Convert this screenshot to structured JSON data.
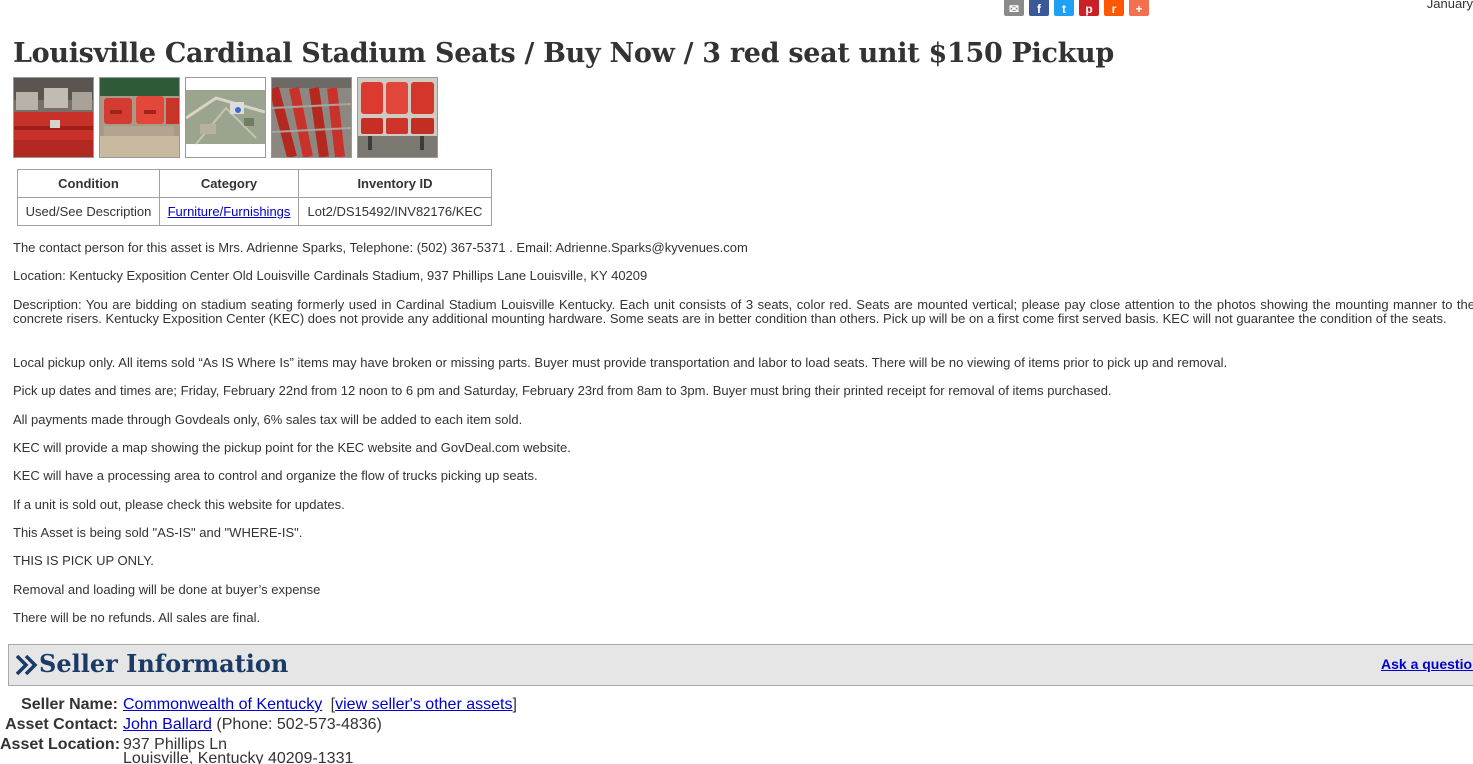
{
  "header": {
    "share_icons": [
      {
        "name": "email-share-icon",
        "glyph": "✉",
        "color": "#8a8a8a"
      },
      {
        "name": "facebook-share-icon",
        "glyph": "f",
        "color": "#3b5998"
      },
      {
        "name": "twitter-share-icon",
        "glyph": "t",
        "color": "#1da1f2"
      },
      {
        "name": "pinterest-share-icon",
        "glyph": "p",
        "color": "#cb2027"
      },
      {
        "name": "reddit-share-icon",
        "glyph": "r",
        "color": "#ff5700"
      },
      {
        "name": "more-share-icon",
        "glyph": "+",
        "color": "#f26f4f"
      }
    ],
    "date_text": "January"
  },
  "listing": {
    "title": "Louisville Cardinal Stadium Seats / Buy Now / 3 red seat unit $150 Pickup",
    "thumbnails": [
      "seat-photo-1",
      "seat-photo-2",
      "aerial-map-photo",
      "seat-rows-photo",
      "seat-unit-photo"
    ]
  },
  "info_table": {
    "headers": [
      "Condition",
      "Category",
      "Inventory ID"
    ],
    "condition": "Used/See Description",
    "category": "Furniture/Furnishings",
    "inventory_id": "Lot2/DS15492/INV82176/KEC"
  },
  "description": {
    "contact": "The contact person for this asset is Mrs. Adrienne Sparks, Telephone: (502) 367-5371 . Email: Adrienne.Sparks@kyvenues.com",
    "location": "Location: Kentucky Exposition Center Old Louisville Cardinals Stadium, 937 Phillips Lane Louisville, KY 40209",
    "description": "Description: You are bidding on stadium seating formerly used in Cardinal Stadium Louisville Kentucky. Each unit consists of 3 seats, color red. Seats are mounted vertical; please pay close attention to the photos showing the mounting manner to the concrete risers. Kentucky Exposition Center (KEC) does not provide any additional mounting hardware. Some seats are in better condition than others. Pick up will be on a first come first served basis. KEC will not guarantee the condition of the seats.",
    "local_pickup": "Local pickup only. All items sold “As IS Where Is” items may have broken or missing parts. Buyer must provide transportation and labor to load seats. There will be no viewing of items prior to pick up and removal.",
    "pickup_dates": "Pick up dates and times are; Friday, February 22nd from 12 noon to 6 pm and Saturday, February 23rd from 8am to 3pm. Buyer must bring their printed receipt for removal of items purchased.",
    "payments": "All payments made through Govdeals only, 6% sales tax will be added to each item sold.",
    "map": "KEC will provide a map showing the pickup point for the KEC website and GovDeal.com website.",
    "processing": "KEC will have a processing area to control and organize the flow of trucks picking up seats.",
    "sold_out": "If a unit is sold out, please check this website for updates.",
    "as_is": "This Asset is being sold \"AS-IS\" and \"WHERE-IS\".",
    "pickup_only": "THIS IS PICK UP ONLY.",
    "removal": "Removal and loading will be done at buyer’s expense",
    "refunds": "There will be no refunds. All sales are final."
  },
  "seller": {
    "section_title": "Seller Information",
    "ask_link": "Ask a question",
    "name_label": "Seller Name:",
    "name_value": "Commonwealth of Kentucky",
    "other_assets_link": "view seller's other assets",
    "contact_label": "Asset Contact:",
    "contact_name": "John Ballard",
    "contact_phone": "(Phone: 502-573-4836)",
    "location_label": "Asset Location:",
    "location_line1": "937 Phillips Ln",
    "location_line2": "Louisville, Kentucky 40209-1331"
  }
}
